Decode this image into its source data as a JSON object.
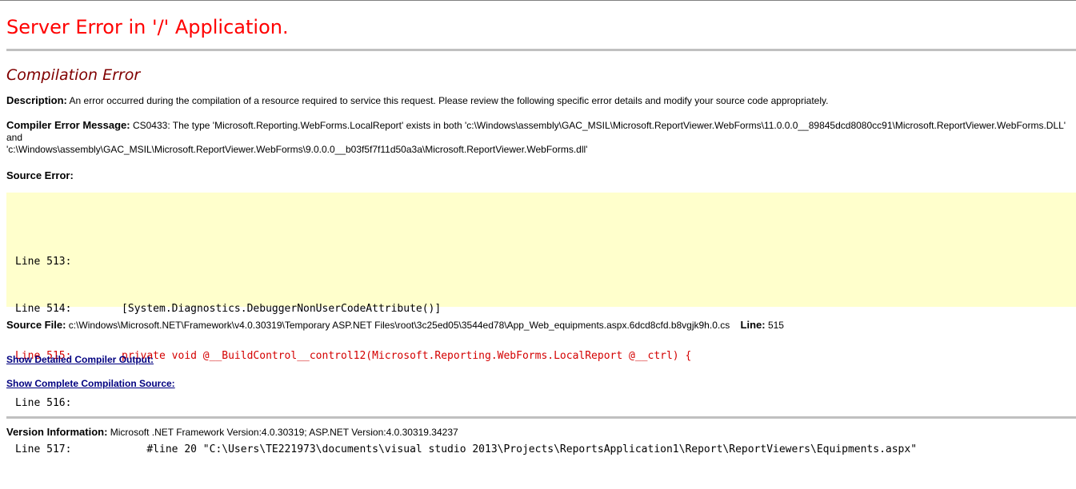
{
  "page": {
    "title": "Server Error in '/' Application.",
    "subtitle": "Compilation Error",
    "description": {
      "label": "Description:",
      "text": "An error occurred during the compilation of a resource required to service this request. Please review the following specific error details and modify your source code appropriately."
    },
    "compiler_error": {
      "label": "Compiler Error Message:",
      "line1": "CS0433: The type 'Microsoft.Reporting.WebForms.LocalReport' exists in both 'c:\\Windows\\assembly\\GAC_MSIL\\Microsoft.ReportViewer.WebForms\\11.0.0.0__89845dcd8080cc91\\Microsoft.ReportViewer.WebForms.DLL' and",
      "line2": "'c:\\Windows\\assembly\\GAC_MSIL\\Microsoft.ReportViewer.WebForms\\9.0.0.0__b03f5f7f11d50a3a\\Microsoft.ReportViewer.WebForms.dll'"
    },
    "source_error": {
      "label": "Source Error:",
      "lines": [
        {
          "text": "Line 513:",
          "highlight": false
        },
        {
          "text": "Line 514:        [System.Diagnostics.DebuggerNonUserCodeAttribute()]",
          "highlight": false
        },
        {
          "text": "Line 515:        private void @__BuildControl__control12(Microsoft.Reporting.WebForms.LocalReport @__ctrl) {",
          "highlight": true
        },
        {
          "text": "Line 516:",
          "highlight": false
        },
        {
          "text": "Line 517:            #line 20 \"C:\\Users\\TE221973\\documents\\visual studio 2013\\Projects\\ReportsApplication1\\Report\\ReportViewers\\Equipments.aspx\"",
          "highlight": false
        }
      ]
    },
    "source_file": {
      "label": "Source File:",
      "path": "c:\\Windows\\Microsoft.NET\\Framework\\v4.0.30319\\Temporary ASP.NET Files\\root\\3c25ed05\\3544ed78\\App_Web_equipments.aspx.6dcd8cfd.b8vgjk9h.0.cs",
      "line_label": "Line:",
      "line_value": "515"
    },
    "links": {
      "detailed_output": "Show Detailed Compiler Output:",
      "complete_source": "Show Complete Compilation Source:"
    },
    "version": {
      "label": "Version Information:",
      "text": "Microsoft .NET Framework Version:4.0.30319; ASP.NET Version:4.0.30319.34237"
    },
    "colors": {
      "title": "#ff0000",
      "subtitle": "#800000",
      "code_background": "#ffffcc",
      "highlight_line": "#d40000",
      "link": "#000080",
      "rule": "#c0c0c0"
    }
  }
}
